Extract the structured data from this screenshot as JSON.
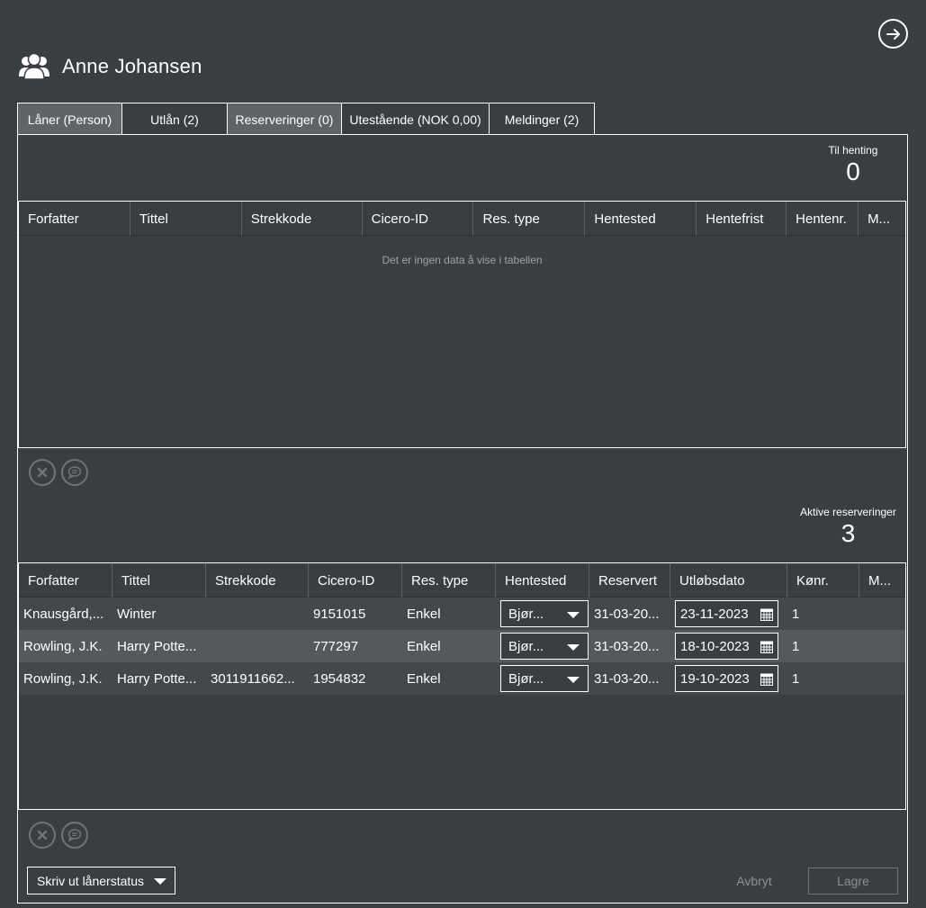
{
  "header": {
    "user_name": "Anne Johansen"
  },
  "tabs": [
    {
      "label": "Låner (Person)"
    },
    {
      "label": "Utlån (2)"
    },
    {
      "label": "Reserveringer (0)"
    },
    {
      "label": "Utestående (NOK 0,00)"
    },
    {
      "label": "Meldinger (2)"
    }
  ],
  "pickup": {
    "counter_label": "Til henting",
    "counter_value": "0",
    "columns": [
      "Forfatter",
      "Tittel",
      "Strekkode",
      "Cicero-ID",
      "Res. type",
      "Hentested",
      "Hentefrist",
      "Hentenr.",
      "M..."
    ],
    "empty_message": "Det er ingen data å vise i tabellen"
  },
  "active": {
    "counter_label": "Aktive reserveringer",
    "counter_value": "3",
    "columns": [
      "Forfatter",
      "Tittel",
      "Strekkode",
      "Cicero-ID",
      "Res. type",
      "Hentested",
      "Reservert",
      "Utløbsdato",
      "Kønr.",
      "M..."
    ],
    "rows": [
      {
        "author": "Knausgård,...",
        "title": "Winter",
        "barcode": "",
        "cicero": "9151015",
        "type": "Enkel",
        "location": "Bjør...",
        "reserved": "31-03-20...",
        "expiry": "23-11-2023",
        "queue": "1"
      },
      {
        "author": "Rowling, J.K.",
        "title": "Harry Potte...",
        "barcode": "",
        "cicero": "777297",
        "type": "Enkel",
        "location": "Bjør...",
        "reserved": "31-03-20...",
        "expiry": "18-10-2023",
        "queue": "1"
      },
      {
        "author": "Rowling, J.K.",
        "title": "Harry Potte...",
        "barcode": "3011911662...",
        "cicero": "1954832",
        "type": "Enkel",
        "location": "Bjør...",
        "reserved": "31-03-20...",
        "expiry": "19-10-2023",
        "queue": "1"
      }
    ]
  },
  "footer": {
    "print_label": "Skriv ut lånerstatus",
    "cancel_label": "Avbryt",
    "save_label": "Lagre"
  },
  "icons": {
    "exit": "arrow-right-circle-icon",
    "user": "users-icon",
    "delete": "close-circle-icon",
    "message": "speech-bubble-icon",
    "calendar": "calendar-icon"
  }
}
